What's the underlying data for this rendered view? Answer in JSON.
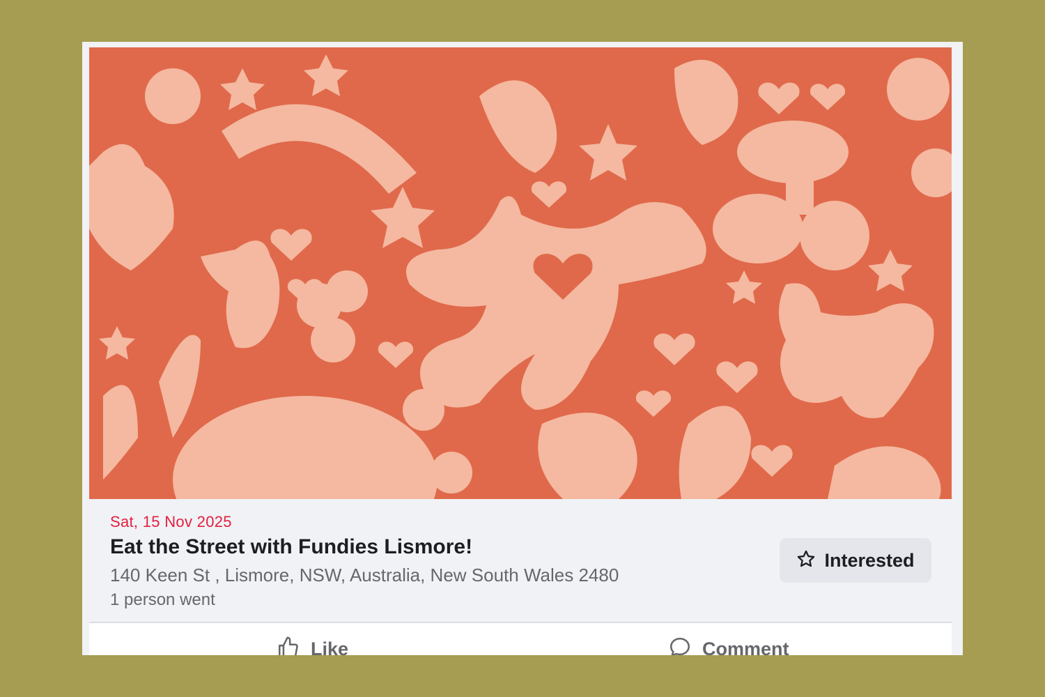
{
  "event": {
    "date": "Sat, 15 Nov 2025",
    "title": "Eat the Street with Fundies Lismore!",
    "address": "140 Keen St , Lismore, NSW, Australia, New South Wales 2480",
    "attendance": "1 person went"
  },
  "buttons": {
    "interested": "Interested",
    "like": "Like",
    "comment": "Comment"
  },
  "icons": {
    "interested": "star-icon",
    "like": "thumbs-up-icon",
    "comment": "comment-bubble-icon"
  },
  "colors": {
    "background": "#a69d52",
    "cover": "#e0694b",
    "cover_pattern": "#f4b9a0",
    "date": "#e41e3f"
  }
}
